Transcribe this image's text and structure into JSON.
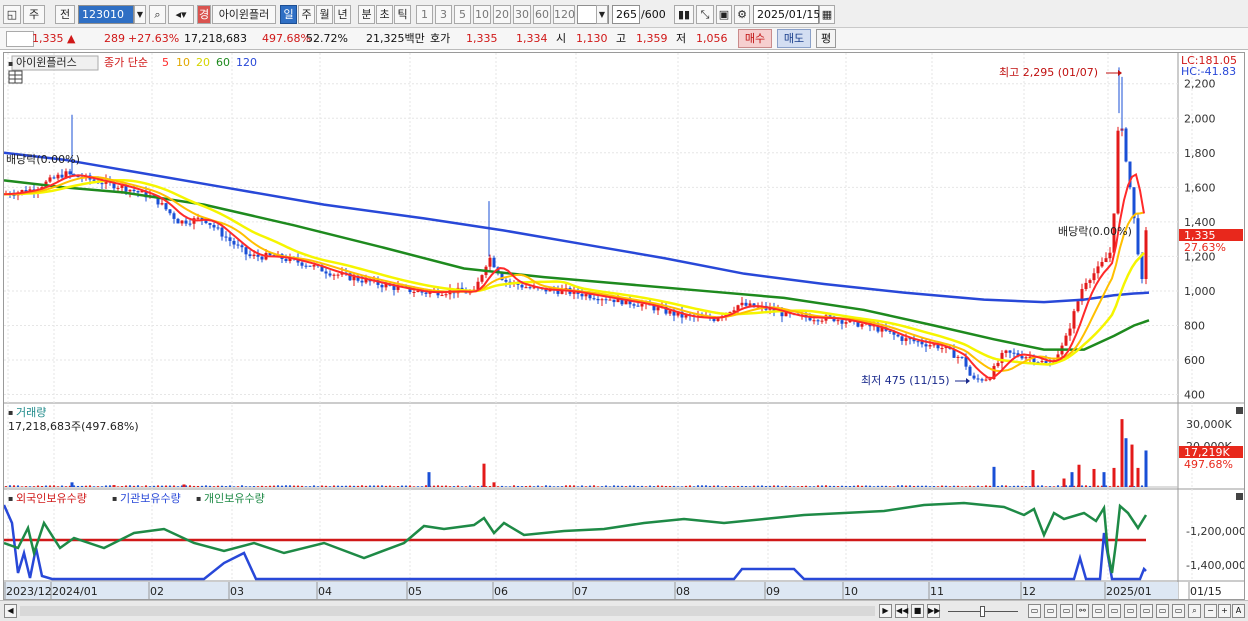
{
  "toolbar": {
    "market": "주",
    "prev": "전",
    "code": "123010",
    "badge": "경",
    "name": "아이윈플러",
    "periods": [
      "일",
      "주",
      "월",
      "년",
      "분",
      "초",
      "틱"
    ],
    "active_period": "일",
    "intervals": [
      "1",
      "3",
      "5",
      "10",
      "20",
      "30",
      "60",
      "120"
    ],
    "count": "265",
    "count_max": "/600",
    "date": "2025/01/15"
  },
  "info": {
    "price": "1,335",
    "arrow": "▲",
    "change": "289",
    "change_pct": "+27.63%",
    "volume": "17,218,683",
    "vol_ratio": "497.68%",
    "turnover": "52.72%",
    "amount": "21,325백만",
    "quote_label": "호가",
    "ask": "1,335",
    "bid": "1,334",
    "open_label": "시",
    "open": "1,130",
    "high_label": "고",
    "high": "1,359",
    "low_label": "저",
    "low": "1,056",
    "buy": "매수",
    "sell": "매도",
    "eval": "평"
  },
  "price_panel": {
    "name": "아이윈플러스",
    "ma_label": "종가 단순",
    "ma_periods": [
      "5",
      "10",
      "20",
      "60",
      "120"
    ],
    "ma_colors": [
      "#ff2a2a",
      "#ffbf00",
      "#f5f500",
      "#1e8a1e",
      "#2848d8"
    ],
    "lc": "LC:181.05",
    "hc": "HC:-41.83",
    "current_tag": "1,335",
    "current_pct_tag": "27.63%",
    "annot_high": "최고 2,295 (01/07)",
    "annot_low": "최저 475 (11/15)",
    "annot_div1": "배당락(0.00%)",
    "annot_div2": "배당락(0.00%)"
  },
  "volume_panel": {
    "title": "거래량",
    "value": "17,218,683주(497.68%)",
    "tag": "17,219K",
    "tag_pct": "497.68%",
    "ticks": [
      "30,000K",
      "20,000K"
    ]
  },
  "holdings_panel": {
    "legend": [
      "외국인보유수량",
      "기관보유수량",
      "개인보유수량"
    ],
    "legend_colors": [
      "#d01818",
      "#2848d8",
      "#1e8a46"
    ],
    "ticks": [
      "-1,200,000",
      "-1,400,000"
    ]
  },
  "x_axis": {
    "labels": [
      "2023/12",
      "2024/01",
      "02",
      "03",
      "04",
      "05",
      "06",
      "07",
      "08",
      "09",
      "10",
      "11",
      "12",
      "2025/01",
      "01/15"
    ]
  },
  "chart_data": {
    "type": "line",
    "y_ticks": [
      2200,
      2000,
      1800,
      1600,
      1400,
      1200,
      1000,
      800,
      600,
      400
    ],
    "ylim": [
      380,
      2320
    ],
    "close": [
      [
        0,
        1560
      ],
      [
        30,
        1590
      ],
      [
        60,
        1680
      ],
      [
        90,
        1640
      ],
      [
        120,
        1600
      ],
      [
        150,
        1540
      ],
      [
        175,
        1400
      ],
      [
        200,
        1420
      ],
      [
        220,
        1320
      ],
      [
        245,
        1200
      ],
      [
        270,
        1200
      ],
      [
        300,
        1160
      ],
      [
        330,
        1100
      ],
      [
        360,
        1060
      ],
      [
        390,
        1020
      ],
      [
        420,
        990
      ],
      [
        450,
        1000
      ],
      [
        470,
        990
      ],
      [
        485,
        1200
      ],
      [
        500,
        1060
      ],
      [
        530,
        1010
      ],
      [
        560,
        1000
      ],
      [
        600,
        960
      ],
      [
        640,
        920
      ],
      [
        680,
        850
      ],
      [
        710,
        840
      ],
      [
        735,
        920
      ],
      [
        760,
        900
      ],
      [
        790,
        850
      ],
      [
        830,
        840
      ],
      [
        870,
        790
      ],
      [
        900,
        720
      ],
      [
        935,
        680
      ],
      [
        960,
        600
      ],
      [
        968,
        480
      ],
      [
        985,
        500
      ],
      [
        1000,
        640
      ],
      [
        1025,
        620
      ],
      [
        1045,
        570
      ],
      [
        1060,
        690
      ],
      [
        1080,
        1050
      ],
      [
        1095,
        1130
      ],
      [
        1108,
        1240
      ],
      [
        1115,
        2030
      ],
      [
        1120,
        1850
      ],
      [
        1126,
        1600
      ],
      [
        1132,
        1320
      ],
      [
        1138,
        1050
      ],
      [
        1142,
        1335
      ]
    ],
    "ma120": [
      [
        0,
        1800
      ],
      [
        60,
        1760
      ],
      [
        130,
        1690
      ],
      [
        220,
        1600
      ],
      [
        320,
        1500
      ],
      [
        420,
        1420
      ],
      [
        500,
        1350
      ],
      [
        580,
        1270
      ],
      [
        660,
        1190
      ],
      [
        740,
        1100
      ],
      [
        820,
        1040
      ],
      [
        900,
        990
      ],
      [
        980,
        950
      ],
      [
        1040,
        935
      ],
      [
        1080,
        950
      ],
      [
        1110,
        975
      ],
      [
        1130,
        985
      ],
      [
        1145,
        990
      ]
    ],
    "ma60": [
      [
        0,
        1640
      ],
      [
        60,
        1600
      ],
      [
        120,
        1570
      ],
      [
        200,
        1500
      ],
      [
        290,
        1380
      ],
      [
        380,
        1250
      ],
      [
        460,
        1130
      ],
      [
        540,
        1080
      ],
      [
        620,
        1040
      ],
      [
        700,
        1000
      ],
      [
        780,
        960
      ],
      [
        860,
        890
      ],
      [
        930,
        800
      ],
      [
        990,
        720
      ],
      [
        1040,
        660
      ],
      [
        1080,
        660
      ],
      [
        1110,
        740
      ],
      [
        1130,
        800
      ],
      [
        1145,
        830
      ]
    ],
    "volume": {
      "spikes": [
        [
          68,
          2200
        ],
        [
          110,
          900
        ],
        [
          180,
          1200
        ],
        [
          425,
          7000
        ],
        [
          480,
          11000
        ],
        [
          490,
          2200
        ],
        [
          990,
          9500
        ],
        [
          1029,
          8000
        ],
        [
          1060,
          4000
        ],
        [
          1068,
          7000
        ],
        [
          1075,
          10500
        ],
        [
          1090,
          8500
        ],
        [
          1100,
          7000
        ],
        [
          1110,
          9000
        ],
        [
          1118,
          32000
        ],
        [
          1122,
          23000
        ],
        [
          1128,
          20000
        ],
        [
          1134,
          9000
        ],
        [
          1142,
          17219
        ]
      ]
    },
    "title": ""
  }
}
